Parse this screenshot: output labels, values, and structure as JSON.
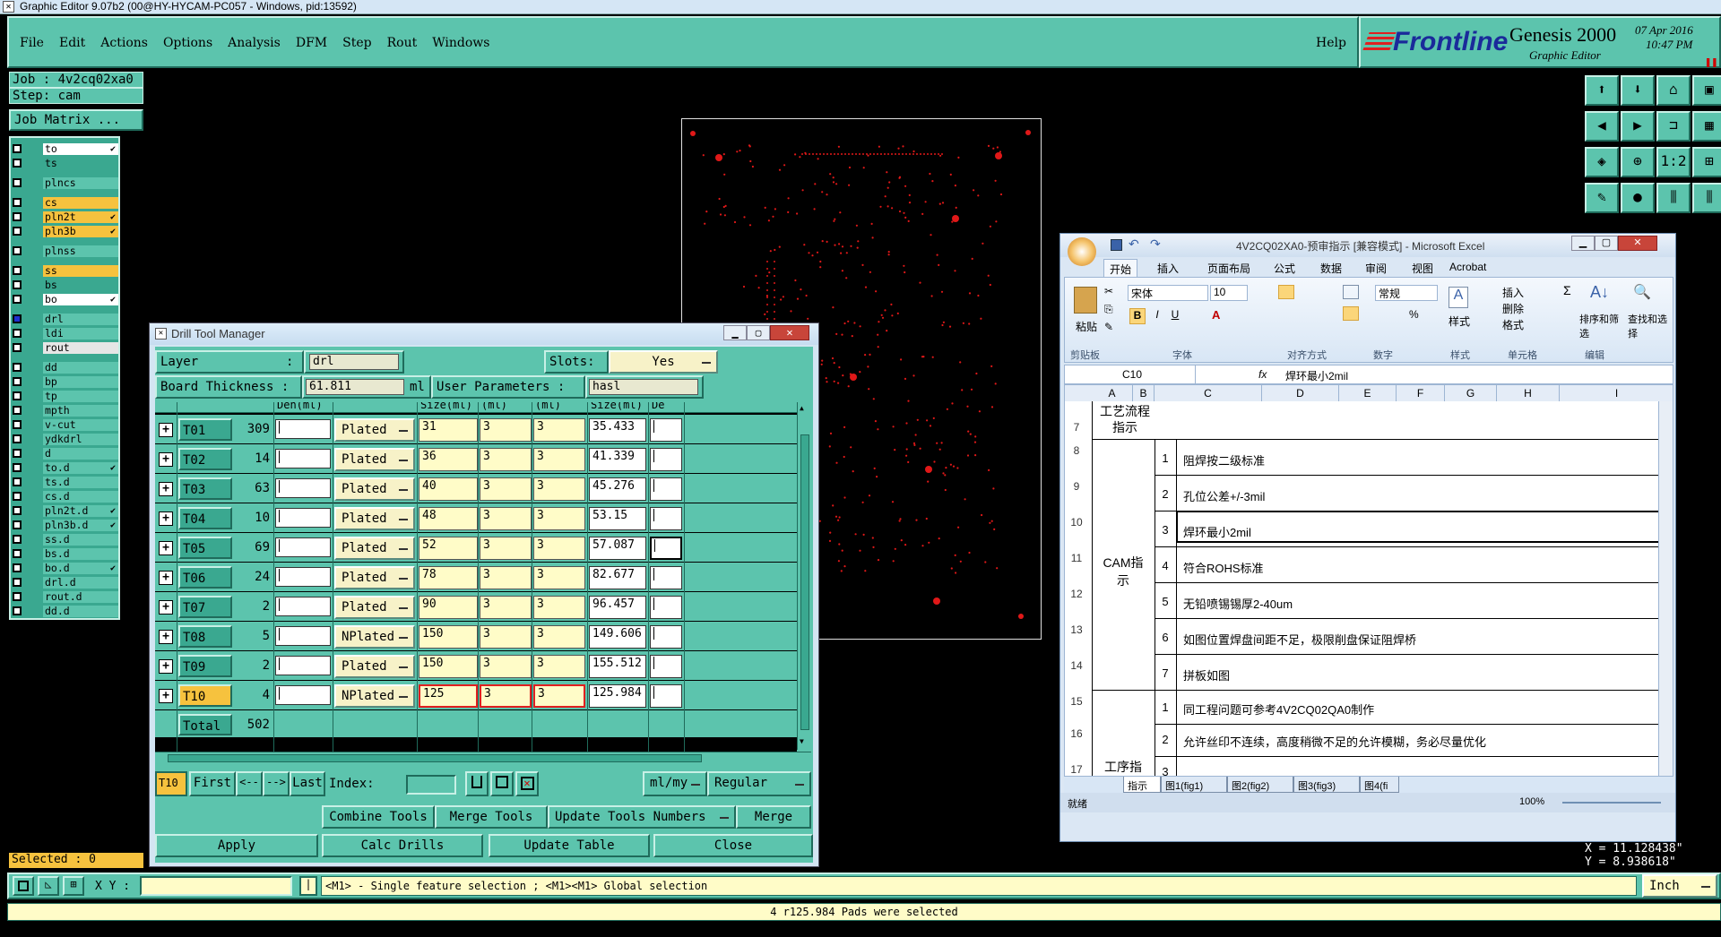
{
  "title_bar": {
    "title": "Graphic Editor 9.07b2 (00@HY-HYCAM-PC057 - Windows, pid:13592)"
  },
  "menu": [
    "File",
    "Edit",
    "Actions",
    "Options",
    "Analysis",
    "DFM",
    "Step",
    "Rout",
    "Windows"
  ],
  "help_label": "Help",
  "brand": {
    "logo": "Frontline",
    "product": "Genesis 2000",
    "subtitle": "Graphic Editor",
    "date": "07 Apr 2016",
    "time": "10:47 PM"
  },
  "job": {
    "job_label": "Job : 4v2cq02xa0",
    "step_label": "Step: cam",
    "matrix_button": "Job Matrix ..."
  },
  "layers": [
    {
      "name": "to",
      "color": "#ffffff",
      "check": true
    },
    {
      "name": "ts",
      "color": "#3aa890"
    },
    {
      "name": "plncs",
      "color": "#5cc4ad"
    },
    {
      "name": "cs",
      "color": "#f6c23e"
    },
    {
      "name": "pln2t",
      "color": "#f6c23e",
      "check": true
    },
    {
      "name": "pln3b",
      "color": "#f6c23e",
      "check": true
    },
    {
      "name": "plnss",
      "color": "#5cc4ad"
    },
    {
      "name": "ss",
      "color": "#f6c23e"
    },
    {
      "name": "bs",
      "color": "#3aa890"
    },
    {
      "name": "bo",
      "color": "#ffffff",
      "check": true
    },
    {
      "name": "drl",
      "color": "#5cc4ad",
      "active": true
    },
    {
      "name": "ldi",
      "color": "#5cc4ad"
    },
    {
      "name": "rout",
      "color": "#e6e6e6"
    },
    {
      "name": "dd",
      "color": "#5cc4ad"
    },
    {
      "name": "bp",
      "color": "#5cc4ad"
    },
    {
      "name": "tp",
      "color": "#5cc4ad"
    },
    {
      "name": "mpth",
      "color": "#5cc4ad"
    },
    {
      "name": "v-cut",
      "color": "#5cc4ad"
    },
    {
      "name": "ydkdrl",
      "color": "#5cc4ad"
    },
    {
      "name": "d",
      "color": "#5cc4ad"
    },
    {
      "name": "to.d",
      "color": "#5cc4ad",
      "check": true
    },
    {
      "name": "ts.d",
      "color": "#5cc4ad"
    },
    {
      "name": "cs.d",
      "color": "#5cc4ad"
    },
    {
      "name": "pln2t.d",
      "color": "#5cc4ad",
      "check": true
    },
    {
      "name": "pln3b.d",
      "color": "#5cc4ad",
      "check": true
    },
    {
      "name": "ss.d",
      "color": "#5cc4ad"
    },
    {
      "name": "bs.d",
      "color": "#5cc4ad"
    },
    {
      "name": "bo.d",
      "color": "#5cc4ad",
      "check": true
    },
    {
      "name": "drl.d",
      "color": "#5cc4ad"
    },
    {
      "name": "rout.d",
      "color": "#5cc4ad"
    },
    {
      "name": "dd.d",
      "color": "#5cc4ad"
    }
  ],
  "selected_label": "Selected : 0",
  "drill": {
    "window_title": "Drill Tool Manager",
    "layer_label": "Layer",
    "layer_colon": ":",
    "layer_value": "drl",
    "slots_label": "Slots:",
    "slots_value": "Yes",
    "board_thickness_label": "Board Thickness :",
    "board_thickness_value": "61.811",
    "board_thickness_unit": "ml",
    "user_params_label": "User Parameters :",
    "user_params_value": "hasl",
    "col_headers": [
      "Den(ml)",
      "Size(ml)",
      "(ml)",
      "(ml)",
      "Size(ml)",
      "De"
    ],
    "rows": [
      {
        "tool": "T01",
        "count": "309",
        "type": "Plated",
        "size": "31",
        "tol1": "3",
        "tol2": "3",
        "final": "35.433"
      },
      {
        "tool": "T02",
        "count": "14",
        "type": "Plated",
        "size": "36",
        "tol1": "3",
        "tol2": "3",
        "final": "41.339"
      },
      {
        "tool": "T03",
        "count": "63",
        "type": "Plated",
        "size": "40",
        "tol1": "3",
        "tol2": "3",
        "final": "45.276"
      },
      {
        "tool": "T04",
        "count": "10",
        "type": "Plated",
        "size": "48",
        "tol1": "3",
        "tol2": "3",
        "final": "53.15"
      },
      {
        "tool": "T05",
        "count": "69",
        "type": "Plated",
        "size": "52",
        "tol1": "3",
        "tol2": "3",
        "final": "57.087"
      },
      {
        "tool": "T06",
        "count": "24",
        "type": "Plated",
        "size": "78",
        "tol1": "3",
        "tol2": "3",
        "final": "82.677"
      },
      {
        "tool": "T07",
        "count": "2",
        "type": "Plated",
        "size": "90",
        "tol1": "3",
        "tol2": "3",
        "final": "96.457"
      },
      {
        "tool": "T08",
        "count": "5",
        "type": "NPlated",
        "size": "150",
        "tol1": "3",
        "tol2": "3",
        "final": "149.606"
      },
      {
        "tool": "T09",
        "count": "2",
        "type": "Plated",
        "size": "150",
        "tol1": "3",
        "tol2": "3",
        "final": "155.512"
      },
      {
        "tool": "T10",
        "count": "4",
        "type": "NPlated",
        "size": "125",
        "tol1": "3",
        "tol2": "3",
        "final": "125.984",
        "selected": true
      }
    ],
    "total_label": "Total",
    "total_value": "502",
    "current_tool": "T10",
    "nav": {
      "first": "First",
      "prev": "<--",
      "next": "-->",
      "last": "Last",
      "index_label": "Index:"
    },
    "units": "ml/my",
    "mode": "Regular",
    "buttons": {
      "combine": "Combine Tools",
      "merge_tools": "Merge Tools",
      "update_numbers": "Update Tools Numbers",
      "merge": "Merge",
      "apply": "Apply",
      "calc": "Calc Drills",
      "update_table": "Update Table",
      "close": "Close"
    }
  },
  "excel": {
    "title": "4V2CQ02XA0-预审指示  [兼容模式] - Microsoft Excel",
    "tabs": [
      "开始",
      "插入",
      "页面布局",
      "公式",
      "数据",
      "审阅",
      "视图",
      "Acrobat"
    ],
    "font_name": "宋体",
    "font_size": "10",
    "number_format": "常规",
    "groups": [
      "剪贴板",
      "字体",
      "对齐方式",
      "数字",
      "样式",
      "单元格",
      "编辑"
    ],
    "ribbon_labels": {
      "paste": "粘贴",
      "style": "样式",
      "insert": "插入",
      "delete": "删除",
      "format": "格式",
      "sort": "排序和筛选",
      "find": "查找和选择"
    },
    "name_box": "C10",
    "fx": "fx",
    "formula": "焊环最小2mil",
    "columns": [
      "A",
      "B",
      "C",
      "D",
      "E",
      "F",
      "G",
      "H",
      "I"
    ],
    "row_numbers": [
      "7",
      "8",
      "9",
      "10",
      "11",
      "12",
      "13",
      "14",
      "15",
      "16",
      "17"
    ],
    "process_header": "工艺流程指示",
    "cam_header": "CAM指示",
    "proc_header": "工序指示",
    "cam_items": [
      {
        "n": "1",
        "text": "阻焊按二级标准"
      },
      {
        "n": "2",
        "text": "孔位公差+/-3mil"
      },
      {
        "n": "3",
        "text": "焊环最小2mil"
      },
      {
        "n": "4",
        "text": "符合ROHS标准"
      },
      {
        "n": "5",
        "text": "无铅喷锡锡厚2-40um"
      },
      {
        "n": "6",
        "text": "如图位置焊盘间距不足，极限削盘保证阻焊桥"
      },
      {
        "n": "7",
        "text": "拼板如图"
      }
    ],
    "proc_items": [
      {
        "n": "1",
        "text": "同工程问题可参考4V2CQ02QA0制作"
      },
      {
        "n": "2",
        "text": "允许丝印不连续，高度稍微不足的允许模糊，务必尽量优化"
      },
      {
        "n": "3",
        "text": ""
      }
    ],
    "sheet_tabs": [
      "指示",
      "图1(fig1)",
      "图2(fig2)",
      "图3(fig3)",
      "图4(fi"
    ],
    "status": "就绪",
    "zoom": "100%"
  },
  "coords": {
    "x": "X = 11.128438\"",
    "y": "Y = 8.938618\""
  },
  "bottom": {
    "xy_label": "X Y :",
    "hint": "<M1> - Single feature selection ; <M1><M1> Global selection",
    "units": "Inch",
    "status": "4 r125.984 Pads were selected"
  }
}
